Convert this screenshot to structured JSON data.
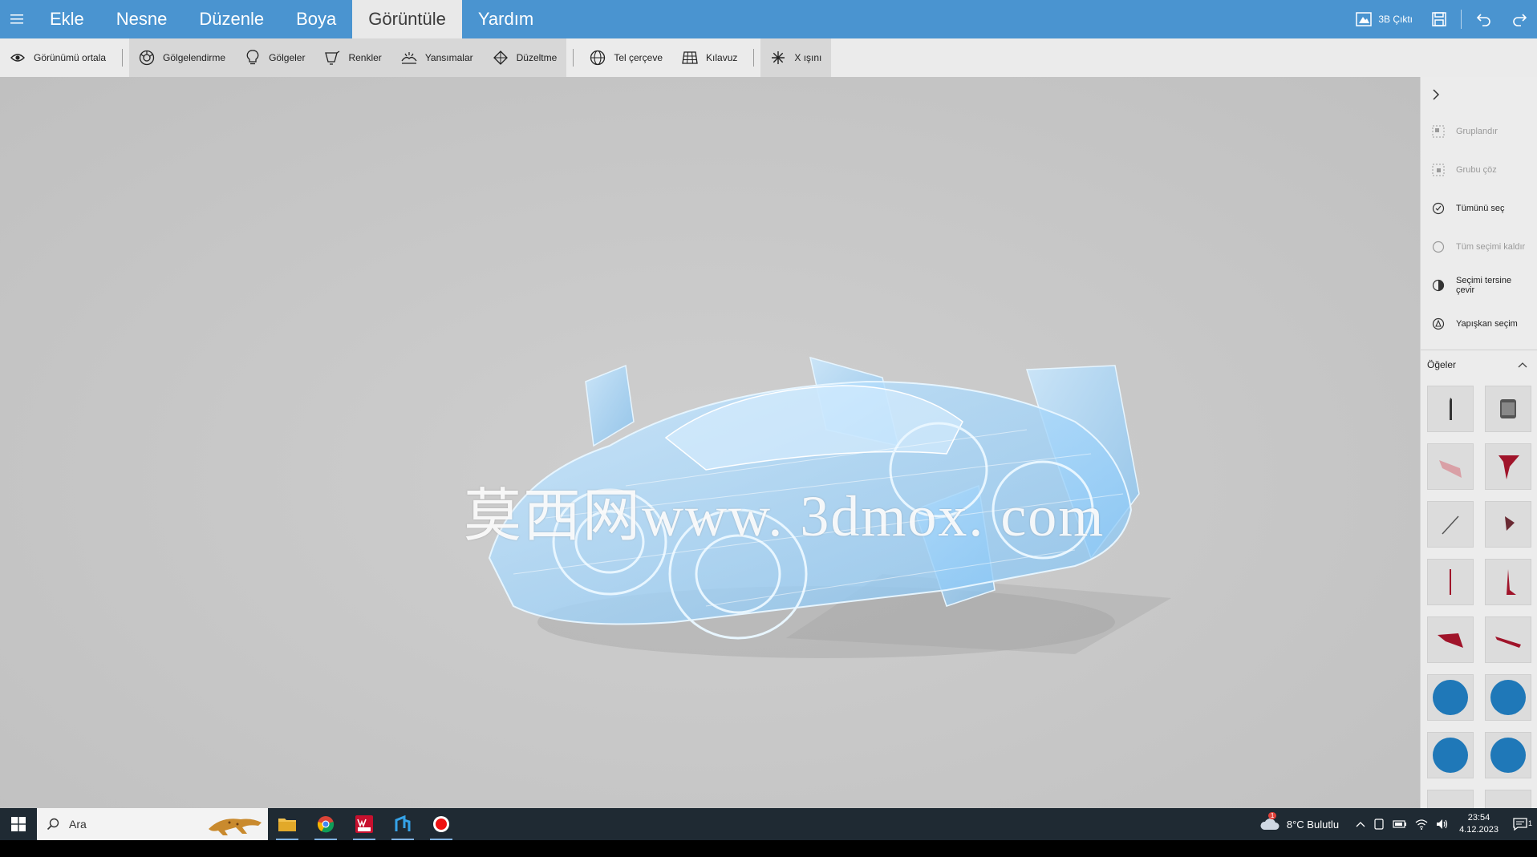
{
  "menubar": {
    "items": [
      "Ekle",
      "Nesne",
      "Düzenle",
      "Boya",
      "Görüntüle",
      "Yardım"
    ],
    "active_index": 4,
    "print_3d_label": "3B Çıktı"
  },
  "toolbar": {
    "center_view": "Görünümü ortala",
    "shading": "Gölgelendirme",
    "shadows": "Gölgeler",
    "colors": "Renkler",
    "reflections": "Yansımalar",
    "smoothing": "Düzeltme",
    "wireframe": "Tel çerçeve",
    "grid": "Kılavuz",
    "xray": "X ışını"
  },
  "viewport": {
    "watermark": "莫西网www. 3dmox. com"
  },
  "right_panel": {
    "group": "Gruplandır",
    "ungroup": "Grubu çöz",
    "select_all": "Tümünü seç",
    "deselect_all": "Tüm seçimi kaldır",
    "invert_selection": "Seçimi tersine çevir",
    "sticky_selection": "Yapışkan seçim",
    "items_header": "Öğeler"
  },
  "taskbar": {
    "search_placeholder": "Ara",
    "weather": "8°C  Bulutlu",
    "weather_badge": "1",
    "time": "23:54",
    "date": "4.12.2023",
    "notification_count": "1"
  },
  "colors": {
    "accent": "#4a94d0",
    "xray_tint": "#9fd3ff",
    "part_red": "#a0142a",
    "part_blue": "#1f78b8"
  }
}
